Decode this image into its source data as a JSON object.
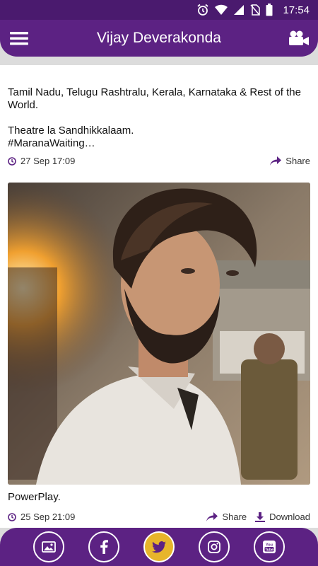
{
  "status_bar": {
    "time": "17:54"
  },
  "app_bar": {
    "title": "Vijay Deverakonda"
  },
  "posts": [
    {
      "text": "Tamil Nadu, Telugu Rashtralu, Kerala, Karnataka & Rest of the World.\n\nTheatre la Sandhikkalaam.\n#MaranaWaiting…",
      "timestamp": "27 Sep 17:09",
      "share_label": "Share"
    },
    {
      "caption": "PowerPlay.",
      "timestamp": "25 Sep 21:09",
      "share_label": "Share",
      "download_label": "Download"
    }
  ],
  "bottom_nav": {
    "items": [
      "gallery-icon",
      "facebook-icon",
      "twitter-icon",
      "instagram-icon",
      "youtube-icon"
    ],
    "active": "twitter-icon"
  },
  "colors": {
    "primary": "#5c2283",
    "status_bar": "#4a1a6e",
    "active": "#e7b52b"
  }
}
